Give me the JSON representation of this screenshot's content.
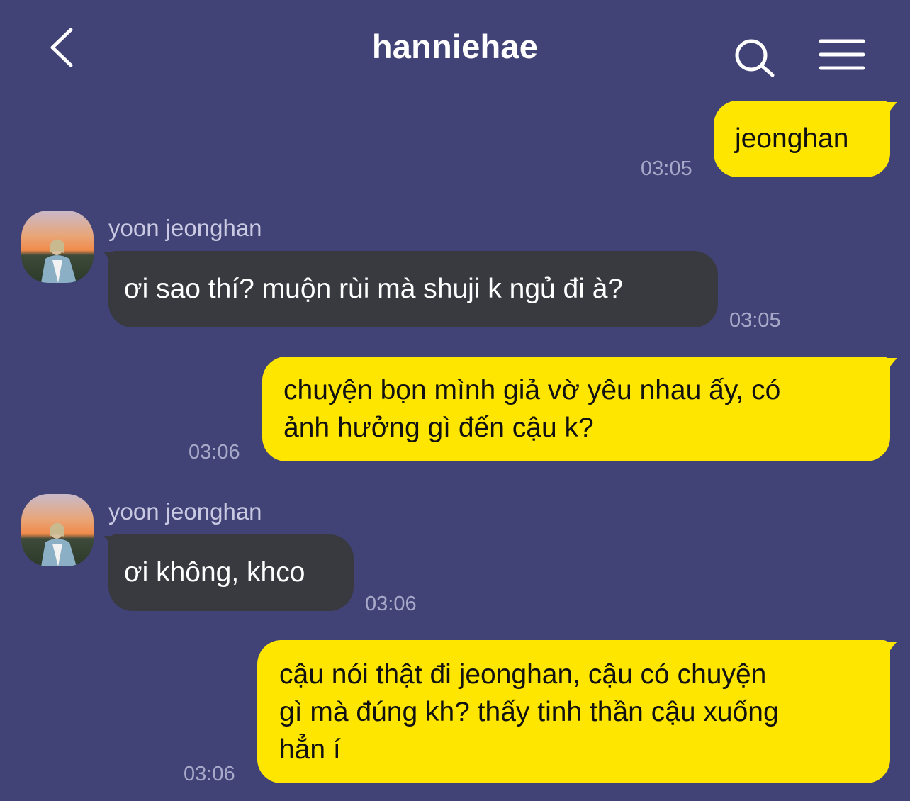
{
  "header": {
    "title": "hanniehae",
    "back_icon": "chevron-left-icon",
    "search_icon": "search-icon",
    "menu_icon": "hamburger-menu-icon"
  },
  "colors": {
    "background": "#414276",
    "my_bubble": "#ffe600",
    "their_bubble": "#393a40",
    "timestamp": "#a8a9c8"
  },
  "messages": [
    {
      "from": "me",
      "lines": [
        "jeonghan"
      ],
      "time": "03:05"
    },
    {
      "from": "them",
      "sender": "yoon jeonghan",
      "lines": [
        "ơi sao thí? muộn rùi mà shuji k ngủ đi à?"
      ],
      "time": "03:05"
    },
    {
      "from": "me",
      "lines": [
        "chuyện bọn mình giả vờ yêu nhau ấy, có",
        "ảnh hưởng gì đến cậu k?"
      ],
      "time": "03:06"
    },
    {
      "from": "them",
      "sender": "yoon jeonghan",
      "lines": [
        "ơi không, khco"
      ],
      "time": "03:06"
    },
    {
      "from": "me",
      "lines": [
        "cậu nói thật đi jeonghan, cậu có chuyện",
        "gì mà đúng kh? thấy tinh thần cậu xuống",
        "hẳn í"
      ],
      "time": "03:06"
    }
  ]
}
